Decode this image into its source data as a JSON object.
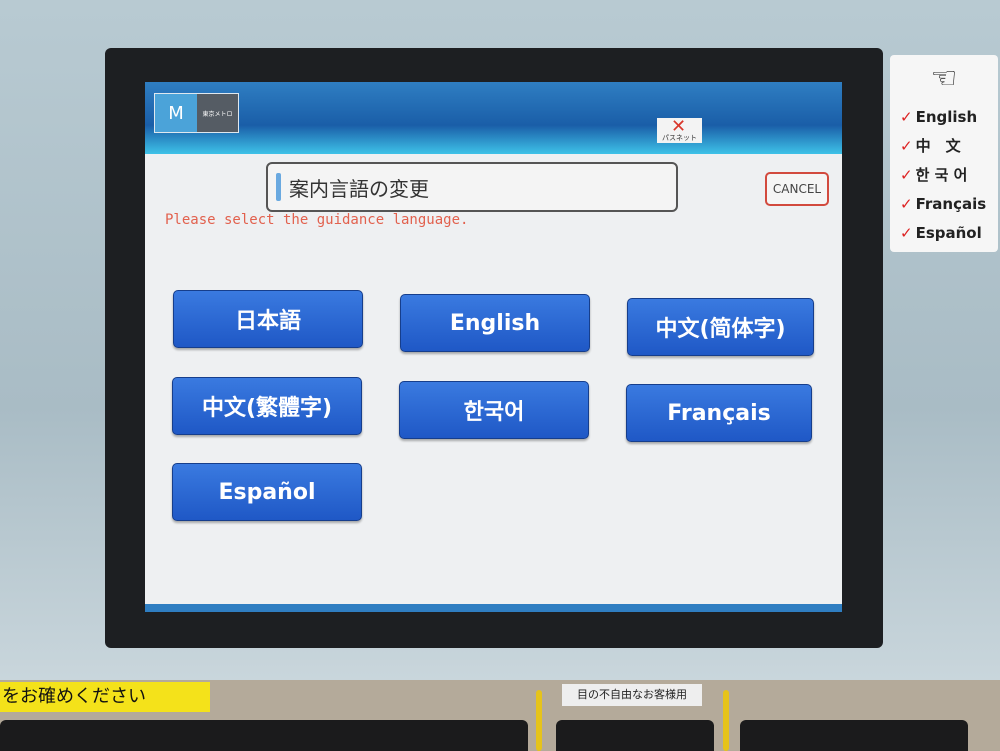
{
  "header": {
    "logo_symbol": "M",
    "logo_text": "東京メトロ",
    "pasmo_label": "パスネット",
    "pasmo_status": "disabled"
  },
  "title": "案内言語の変更",
  "cancel_label": "CANCEL",
  "prompt": "Please select the guidance language.",
  "languages": [
    "日本語",
    "English",
    "中文(简体字)",
    "中文(繁體字)",
    "한국어",
    "Français",
    "Español"
  ],
  "sticker": {
    "icon": "pointing-hand-icon",
    "items": [
      "English",
      "中　文",
      "한 국 어",
      "Français",
      "Español"
    ]
  },
  "machine": {
    "yellow_label": "をお確めください",
    "accessibility_label": "目の不自由なお客様用"
  },
  "colors": {
    "button": "#2a66d4",
    "prompt": "#e2614e",
    "cancel_border": "#d24a3e"
  }
}
